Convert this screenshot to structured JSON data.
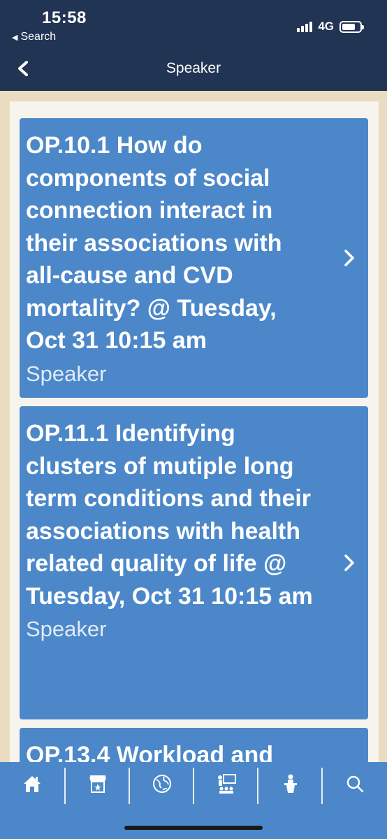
{
  "status_bar": {
    "time": "15:58",
    "back_app": "Search",
    "network": "4G"
  },
  "nav": {
    "title": "Speaker",
    "back_icon": "chevron-left-icon"
  },
  "sessions": [
    {
      "title": "OP.10.1 How do components of social connection interact in their associations with all-cause and CVD mortality? @ Tuesday, Oct 31 10:15 am",
      "role": "Speaker"
    },
    {
      "title": "OP.11.1 Identifying clusters of mutiple long term conditions and their associations with health related quality of life @ Tuesday, Oct 31 10:15 am",
      "role": "Speaker"
    },
    {
      "title": "OP.13.4 Workload and"
    }
  ],
  "tab_bar": {
    "items": [
      "home-icon",
      "booth-icon",
      "globe-icon",
      "presentation-icon",
      "speaker-podium-icon",
      "search-icon"
    ]
  },
  "colors": {
    "header": "#223453",
    "card": "#4c88c9",
    "tab_bar": "#4c88c9",
    "background": "#f7f4ee"
  }
}
